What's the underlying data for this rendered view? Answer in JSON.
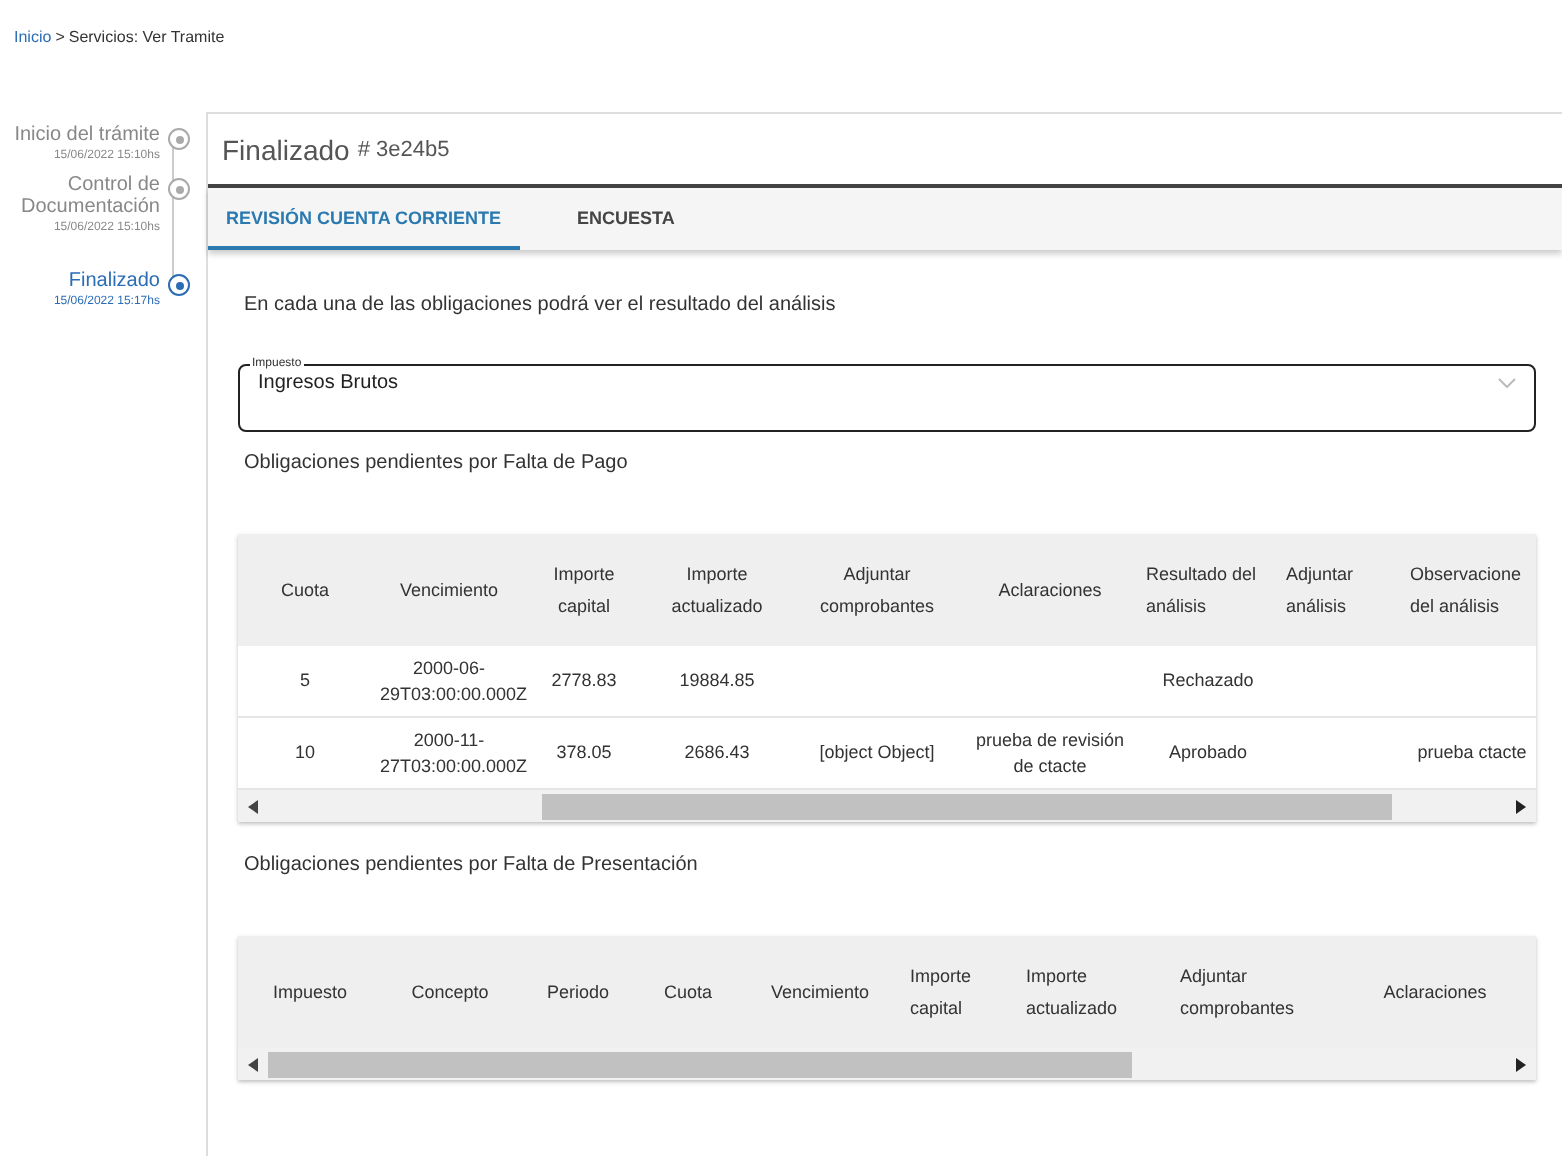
{
  "breadcrumb": {
    "link": "Inicio",
    "separator": ">",
    "current": "Servicios: Ver Tramite"
  },
  "steps": [
    {
      "label": "Inicio del trámite",
      "time": "15/06/2022 15:10hs",
      "active": false
    },
    {
      "label": "Control de Documentación",
      "time": "15/06/2022 15:10hs",
      "active": false
    },
    {
      "label": "Finalizado",
      "time": "15/06/2022 15:17hs",
      "active": true
    }
  ],
  "header": {
    "title": "Finalizado",
    "code": "# 3e24b5"
  },
  "tabs": [
    {
      "label": "REVISIÓN CUENTA CORRIENTE",
      "selected": true
    },
    {
      "label": "ENCUESTA",
      "selected": false
    }
  ],
  "intro": "En cada una de las obligaciones podrá ver el resultado del análisis",
  "tax_select": {
    "label": "Impuesto",
    "value": "Ingresos Brutos"
  },
  "payment_table": {
    "title": "Obligaciones pendientes por Falta de Pago",
    "columns": [
      "Cuota",
      "Vencimiento",
      "Importe capital",
      "Importe actualizado",
      "Adjuntar comprobantes",
      "Aclaraciones",
      "Resultado del análisis",
      "Adjuntar análisis",
      "Observacione del análisis"
    ],
    "rows": [
      [
        "5",
        "2000-06-29T03:00:00.000Z",
        "2778.83",
        "19884.85",
        "",
        "",
        "Rechazado",
        "",
        ""
      ],
      [
        "10",
        "2000-11-27T03:00:00.000Z",
        "378.05",
        "2686.43",
        "[object Object]",
        "prueba de revisión de ctacte",
        "Aprobado",
        "",
        "prueba ctacte"
      ]
    ]
  },
  "filing_table": {
    "title": "Obligaciones pendientes por Falta de Presentación",
    "columns": [
      "Impuesto",
      "Concepto",
      "Periodo",
      "Cuota",
      "Vencimiento",
      "Importe capital",
      "Importe actualizado",
      "Adjuntar comprobantes",
      "Aclaraciones"
    ]
  }
}
